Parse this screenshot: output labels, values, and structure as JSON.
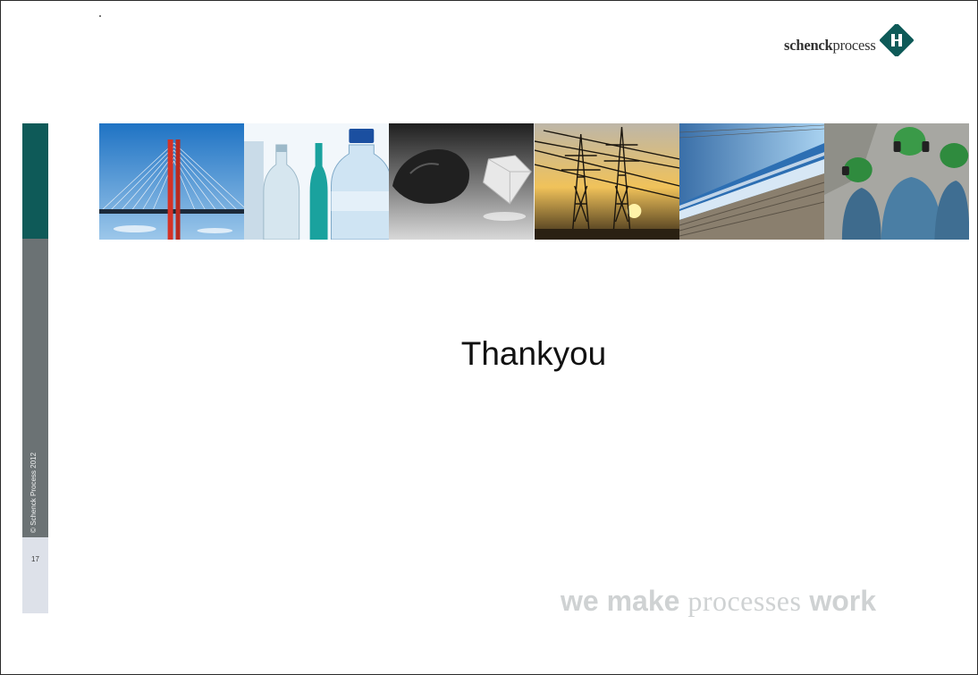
{
  "logo": {
    "word_bold": "schenck",
    "word_regular": "process"
  },
  "sidebar": {
    "copyright": "© Schenck Process  2012",
    "page_number": "17"
  },
  "banner": {
    "panels": [
      "bridge-photo",
      "water-bottles-photo",
      "coal-and-diamond-photo",
      "power-pylons-photo",
      "train-photo",
      "workers-helmets-photo"
    ]
  },
  "slide": {
    "title": "Thankyou"
  },
  "tagline": {
    "w1": "we make",
    "w2": "processes",
    "w3": "work"
  },
  "colors": {
    "brand_teal": "#0e5a58",
    "sidebar_grey": "#6b7274",
    "sidebar_light": "#dde1e9",
    "tagline": "#cfd2d3"
  }
}
